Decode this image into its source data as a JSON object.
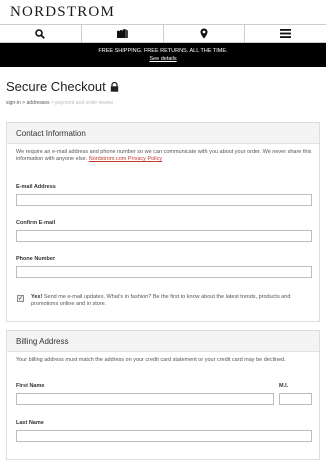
{
  "header": {
    "brand": "NORDSTROM",
    "icons": [
      "search-icon",
      "shopping-bag-icon",
      "location-pin-icon",
      "menu-icon"
    ]
  },
  "promo": {
    "text": "FREE SHIPPING. FREE RETURNS. ALL THE TIME.",
    "link": "See details"
  },
  "page": {
    "title": "Secure Checkout",
    "breadcrumb": {
      "step1": "sign-in",
      "sep1": ">",
      "step2": "addresses",
      "sep2": ">",
      "rest": "payment and order review"
    }
  },
  "contact": {
    "heading": "Contact Information",
    "intro_text": "We require an e-mail address and phone number so we can communicate with you about your order. We never share this information with anyone else.",
    "policy_link": "Nordstrom.com Privacy Policy",
    "email_label": "E-mail Address",
    "confirm_email_label": "Confirm E-mail",
    "phone_label": "Phone Number",
    "optin_yes": "Yes!",
    "optin_text": "Send me e-mail updates. What's in fashion? Be the first to know about the latest trends, products and promotions online and in store.",
    "optin_checked": true
  },
  "billing": {
    "heading": "Billing Address",
    "intro_text": "Your billing address must match the address on your credit card statement or your credit card may be declined.",
    "first_name_label": "First Name",
    "mi_label": "M.I.",
    "last_name_label": "Last Name"
  },
  "colors": {
    "promo_bg": "#000000",
    "link": "#c0392b",
    "section_head_bg": "#f4f4f4"
  }
}
